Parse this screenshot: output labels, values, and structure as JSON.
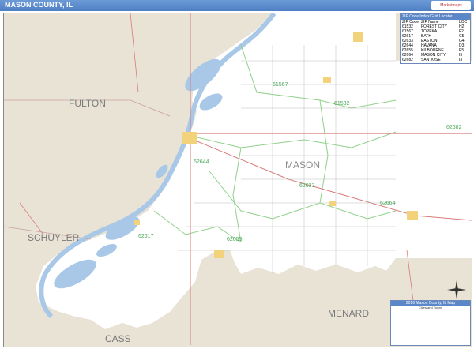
{
  "header": {
    "title": "MASON COUNTY, IL",
    "logo_text": "Marketmaps"
  },
  "map": {
    "county_labels": [
      "FULTON",
      "SCHUYLER",
      "MASON",
      "MENARD",
      "CASS"
    ],
    "zip_labels": [
      "61567",
      "61532",
      "62682",
      "62644",
      "62633",
      "62664",
      "62617",
      "62655"
    ],
    "colors": {
      "land_outside": "#e9e3d6",
      "county": "#ffffff",
      "water": "#a9c8e8",
      "zip_boundary": "#8fd08a",
      "highway": "#d87a7a",
      "road": "#999999",
      "city": "#f2d27a"
    }
  },
  "zip_index": {
    "title": "ZIP Code Index/Grid Locator",
    "columns": [
      "ZIP Code",
      "ZIP Name",
      "LOC"
    ],
    "rows": [
      [
        "61532",
        "FOREST CITY",
        "H2"
      ],
      [
        "61567",
        "TOPEKA",
        "F2"
      ],
      [
        "62617",
        "BATH",
        "C5"
      ],
      [
        "62633",
        "EASTON",
        "G4"
      ],
      [
        "62644",
        "HAVANA",
        "D3"
      ],
      [
        "62655",
        "KILBOURNE",
        "E5"
      ],
      [
        "62664",
        "MASON CITY",
        "I5"
      ],
      [
        "62682",
        "SAN JOSE",
        "I3"
      ]
    ]
  },
  "legend": {
    "title": "2016 Mason County, IL Map",
    "subtitle": "Cities and Towns",
    "rows": [
      [
        "",
        "",
        ""
      ],
      [
        "",
        "",
        ""
      ],
      [
        "",
        "",
        ""
      ],
      [
        "",
        "",
        ""
      ],
      [
        "",
        "",
        ""
      ],
      [
        "",
        "",
        ""
      ],
      [
        "",
        "",
        ""
      ],
      [
        "",
        "",
        ""
      ],
      [
        "",
        "",
        ""
      ]
    ]
  }
}
